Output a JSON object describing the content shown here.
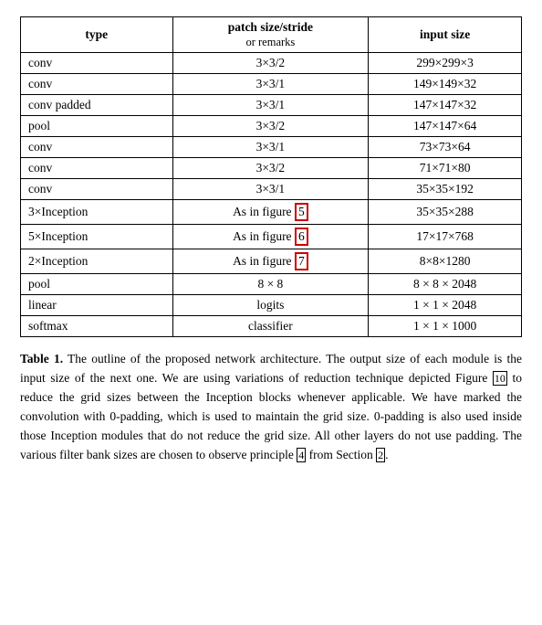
{
  "table": {
    "headers": {
      "type": "type",
      "patch": "patch size/stride",
      "patch_sub": "or remarks",
      "input": "input size"
    },
    "rows": [
      {
        "type": "conv",
        "patch": "3×3/2",
        "input": "299×299×3"
      },
      {
        "type": "conv",
        "patch": "3×3/1",
        "input": "149×149×32"
      },
      {
        "type": "conv padded",
        "patch": "3×3/1",
        "input": "147×147×32"
      },
      {
        "type": "pool",
        "patch": "3×3/2",
        "input": "147×147×64"
      },
      {
        "type": "conv",
        "patch": "3×3/1",
        "input": "73×73×64"
      },
      {
        "type": "conv",
        "patch": "3×3/2",
        "input": "71×71×80"
      },
      {
        "type": "conv",
        "patch": "3×3/1",
        "input": "35×35×192"
      },
      {
        "type": "3×Inception",
        "patch": "As in figure 5",
        "input": "35×35×288",
        "highlight": "5"
      },
      {
        "type": "5×Inception",
        "patch": "As in figure 6",
        "input": "17×17×768",
        "highlight": "6"
      },
      {
        "type": "2×Inception",
        "patch": "As in figure 7",
        "input": "8×8×1280",
        "highlight": "7"
      },
      {
        "type": "pool",
        "patch": "8 × 8",
        "input": "8 × 8 × 2048"
      },
      {
        "type": "linear",
        "patch": "logits",
        "input": "1 × 1 × 2048"
      },
      {
        "type": "softmax",
        "patch": "classifier",
        "input": "1 × 1 × 1000"
      }
    ]
  },
  "caption": {
    "label": "Table 1.",
    "text": " The outline of the proposed network architecture.  The output size of each module is the input size of the next one.  We are using variations of reduction technique depicted Figure ",
    "ref_10": "10",
    "text2": " to reduce the grid sizes between the Inception blocks whenever applicable. We have marked the convolution with 0-padding, which is used to maintain the grid size.  0-padding is also used inside those Inception modules that do not reduce the grid size. All other layers do not use padding. The various filter bank sizes are chosen to observe principle ",
    "ref_4": "4",
    "text3": " from Section ",
    "ref_2": "2",
    "text4": "."
  }
}
